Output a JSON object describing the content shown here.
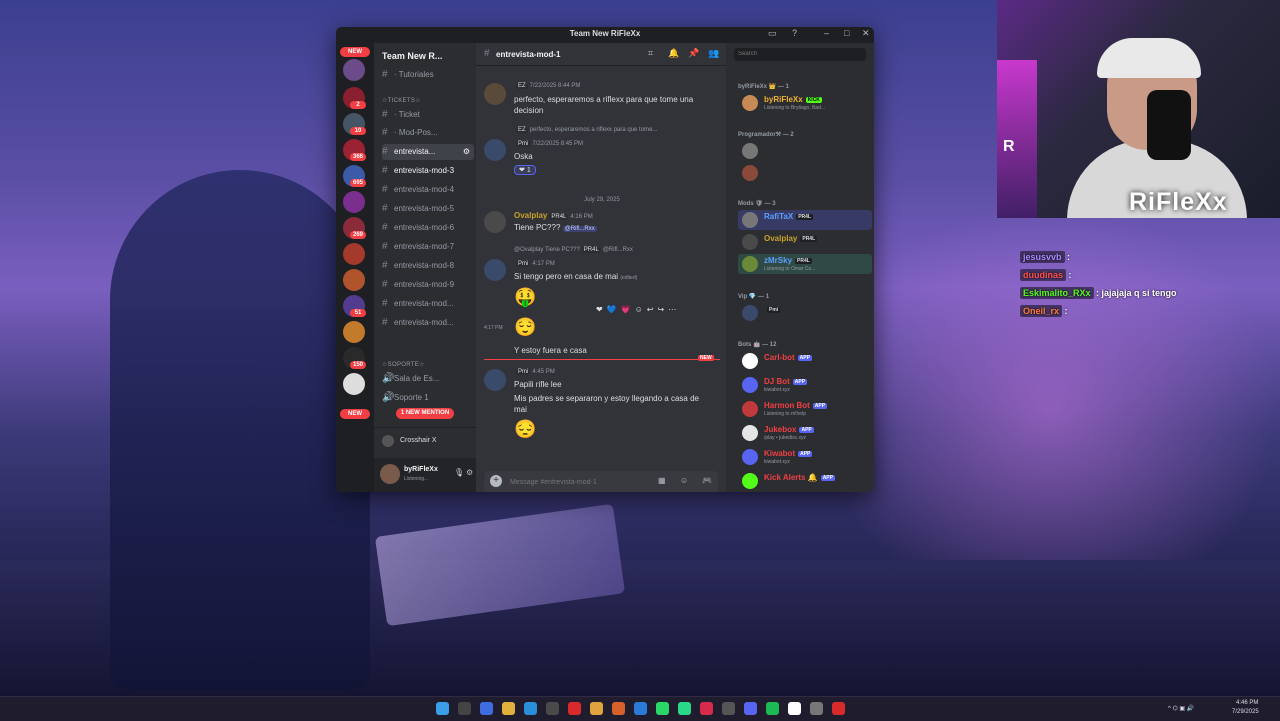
{
  "window": {
    "title": "Team New RiFleXx"
  },
  "servers": {
    "new_label": "NEW",
    "badges": [
      "2",
      "10",
      "366",
      "695",
      "269",
      "51",
      "150"
    ],
    "new_bottom": "NEW",
    "new_mention": "1 NEW MENTION"
  },
  "sidebar": {
    "guild_name": "Team New R...",
    "channels_top": [
      {
        "label": "· Tutoriales"
      }
    ],
    "category_tickets": "☆TICKETS☆",
    "tickets": [
      {
        "label": "· Ticket"
      },
      {
        "label": "· Mod-Pos..."
      }
    ],
    "active_channel": "entrevista...",
    "channels": [
      "entrevista-mod-3",
      "entrevista-mod-4",
      "entrevista-mod-5",
      "entrevista-mod-6",
      "entrevista-mod-7",
      "entrevista-mod-8",
      "entrevista-mod-9",
      "entrevista-mod...",
      "entrevista-mod..."
    ],
    "category_soporte": "☆SOPORTE☆",
    "voice_channels": [
      "Sala de Es...",
      "Soporte 1"
    ],
    "voice_status": "Crosshair X",
    "user_name": "byRiFleXx",
    "user_status": "Listening..."
  },
  "chat": {
    "channel_name": "entrevista-mod-1",
    "messages": [
      {
        "meta": "7/22/2025 8:44 PM",
        "tag": "EZ",
        "text": "perfecto, esperaremos a riflexx para que tome una decision"
      },
      {
        "reply": "perfecto, esperaremos a riflexx para que tome...",
        "reply_tag": "EZ",
        "tag": "Pmi",
        "meta": "7/22/2025 8:45 PM",
        "text": "Oska",
        "reaction_count": "1"
      },
      {
        "divider": "July 29, 2025"
      },
      {
        "name": "Ovalplay",
        "tag": "PR4L",
        "meta": "4:16 PM",
        "text": "Tiene PC???",
        "mention": "@Rifl...Rxx"
      },
      {
        "reply": "@Ovalplay Tiene PC???",
        "reply_tag": "PR4L",
        "reply_mention": "@Rifl...Rxx",
        "tag": "Pmi",
        "meta": "4:17 PM",
        "text": "Si tengo pero en casa de mai",
        "edited": "(edited)"
      },
      {
        "time": "4:17 PM",
        "emoji1": "🤑",
        "emoji2": "😌",
        "text": "Y estoy fuera e casa"
      },
      {
        "new_label": "NEW"
      },
      {
        "tag": "Pmi",
        "meta": "4:45 PM",
        "text1": "Papili rifle lee",
        "text2": "Mis padres se separaron y estoy llegando a casa de mai",
        "emoji": "😔"
      }
    ],
    "composer_placeholder": "Message #entrevista-mod-1"
  },
  "members": {
    "search_placeholder": "Search",
    "groups": [
      {
        "label": "byRiFleXx 👑 — 1"
      },
      {
        "label": "Programador⚒ — 2"
      },
      {
        "label": "Mods 🛡 — 3"
      },
      {
        "label": "Vip 💎 — 1"
      },
      {
        "label": "Bots 🤖 — 12"
      }
    ],
    "list": [
      {
        "name": "byRiFleXx",
        "role": "KICK",
        "status": "Listening to Brytiago, Bad...",
        "color": "#f0b232"
      },
      {
        "name": "Ovalplay",
        "role": "PR4L",
        "status": "",
        "color": "#c9a227"
      },
      {
        "name": "RafiTaX",
        "role": "PR4L",
        "status": "",
        "color": "#5aa0ff"
      },
      {
        "name": "Ovalplay",
        "role": "PR4L",
        "status": "",
        "color": "#c9a227"
      },
      {
        "name": "zMrSky",
        "role": "PR4L",
        "status": "Listening to Omar Co...",
        "color": "#5aa0ff"
      },
      {
        "name": "",
        "role": "Pmi",
        "status": "",
        "color": "#f23f43"
      },
      {
        "name": "Carl-bot",
        "role": "APP",
        "status": "",
        "color": "#f23f43"
      },
      {
        "name": "DJ Bot",
        "role": "APP",
        "status": "kiwabot.xyz",
        "color": "#f23f43"
      },
      {
        "name": "Harmon Bot",
        "role": "APP",
        "status": "Listening to m!help",
        "color": "#f23f43"
      },
      {
        "name": "Jukebox",
        "role": "APP",
        "status": "/play • jukedisc.xyz",
        "color": "#f23f43"
      },
      {
        "name": "Kiwabot",
        "role": "APP",
        "status": "kiwabot.xyz",
        "color": "#f23f43"
      },
      {
        "name": "Kick Alerts 🔔",
        "role": "APP",
        "status": "",
        "color": "#f23f43"
      }
    ]
  },
  "stream": {
    "brand": "RiFleXx",
    "corner_letter": "R",
    "chat": [
      {
        "user": "jesusvvb",
        "msg": ""
      },
      {
        "user": "duudinas",
        "msg": ""
      },
      {
        "user": "Eskimalito_RXx",
        "msg": "jajajaja q si tengo"
      },
      {
        "user": "Oneil_rx",
        "msg": ""
      }
    ]
  },
  "taskbar": {
    "time": "4:46 PM",
    "date": "7/29/2025"
  },
  "colors": {
    "discord_bg": "#313338",
    "sidebar_bg": "#2b2d31",
    "server_bg": "#1e1f22",
    "red": "#f23f43",
    "blurple": "#5865f2"
  }
}
